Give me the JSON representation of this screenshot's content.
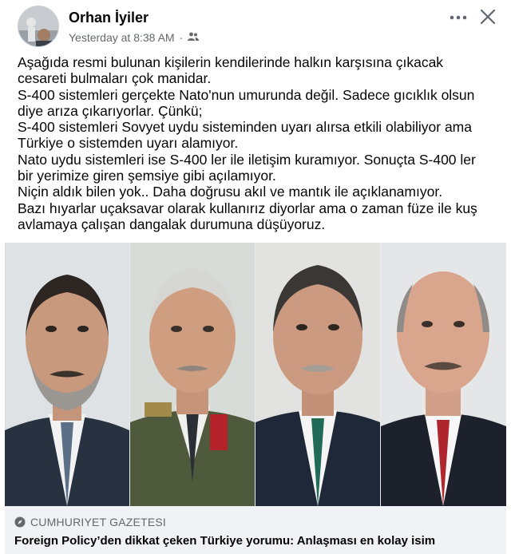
{
  "post": {
    "author": "Orhan İyiler",
    "timestamp": "Yesterday at 8:38 AM",
    "separator": "·",
    "audience_icon": "friends-icon",
    "more_icon": "more-horizontal-icon",
    "close_icon": "close-icon",
    "text_lines": [
      "Aşağıda resmi bulunan kişilerin kendilerinde  halkın karşısına çıkacak",
      "cesareti bulmaları  çok manidar.",
      "S-400 sistemleri gerçekte Nato'nun umurunda değil. Sadece gıcıklık olsun",
      "diye arıza çıkarıyorlar. Çünkü;",
      "S-400 sistemleri Sovyet uydu sisteminden uyarı alırsa etkili olabiliyor ama",
      "Türkiye o sistemden uyarı alamıyor.",
      "Nato uydu sistemleri ise S-400 ler ile iletişim kuramıyor. Sonuçta S-400 ler",
      "bir yerimize giren şemsiye gibi açılamıyor.",
      "Niçin aldık bilen yok.. Daha doğrusu akıl  ve mantık ile açıklanamıyor.",
      "Bazı hıyarlar uçaksavar olarak kullanırız diyorlar ama o zaman füze ile kuş",
      "avlamaya çalışan dangalak durumuna düşüyoruz."
    ]
  },
  "link_preview": {
    "source_icon": "compass-icon",
    "source": "CUMHURIYET GAZETESI",
    "headline": "Foreign Policy’den dikkat çeken Türkiye yorumu: Anlaşması en kolay isim"
  },
  "colors": {
    "text": "#050505",
    "secondary": "#65676b",
    "card_bg": "#f0f2f5"
  }
}
